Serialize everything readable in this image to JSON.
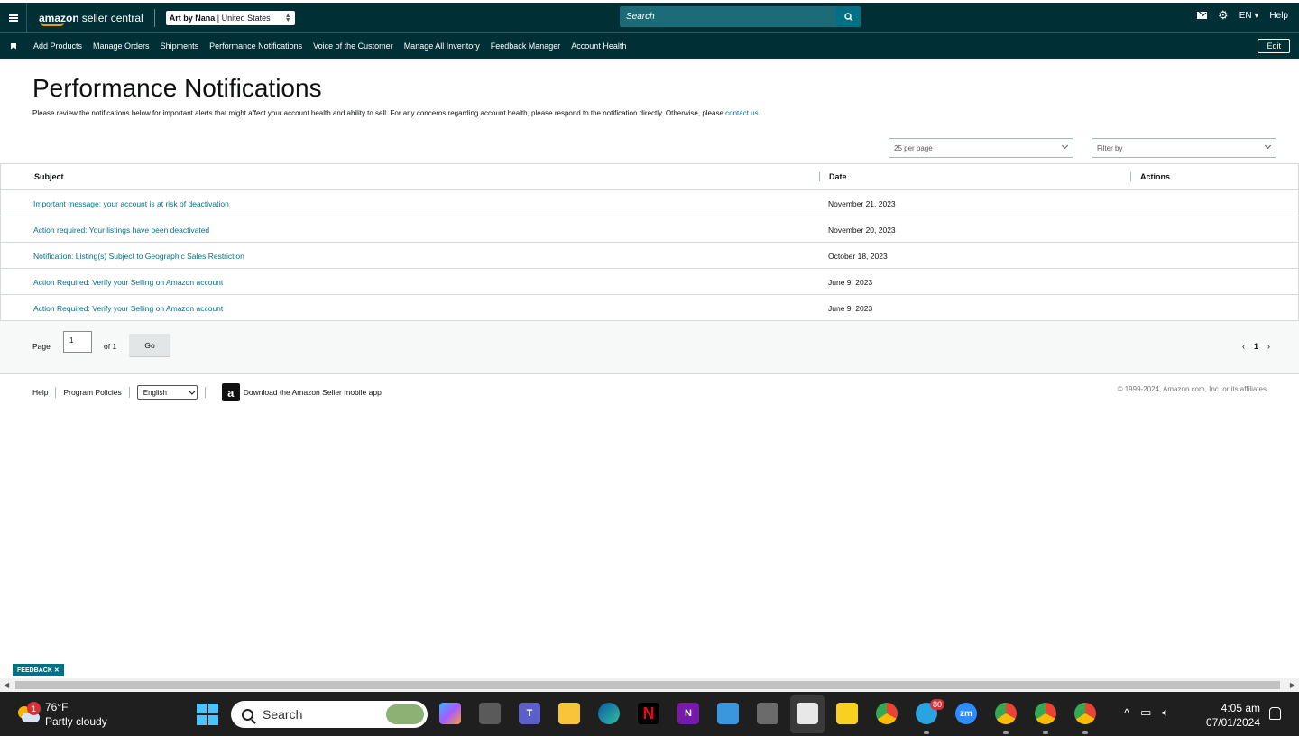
{
  "header": {
    "logo_brand": "amazon",
    "logo_product": "seller central",
    "store_name": "Art by Nana",
    "marketplace": "United States",
    "search_placeholder": "Search",
    "language": "EN",
    "help": "Help"
  },
  "nav": {
    "items": [
      "Add Products",
      "Manage Orders",
      "Shipments",
      "Performance Notifications",
      "Voice of the Customer",
      "Manage All Inventory",
      "Feedback Manager",
      "Account Health"
    ],
    "edit_label": "Edit"
  },
  "page": {
    "title": "Performance Notifications",
    "intro": "Please review the notifications below for important alerts that might affect your account health and ability to sell. For any concerns regarding account health, please respond to the notification directly. Otherwise, please ",
    "intro_link": "contact us.",
    "per_page": "25 per page",
    "filter_placeholder": "Filter by"
  },
  "table": {
    "columns": [
      "Subject",
      "Date",
      "Actions"
    ],
    "rows": [
      {
        "subject": "Important message: your account is at risk of deactivation",
        "date": "November 21, 2023"
      },
      {
        "subject": "Action required: Your listings have been deactivated",
        "date": "November 20, 2023"
      },
      {
        "subject": "Notification: Listing(s) Subject to Geographic Sales Restriction",
        "date": "October 18, 2023"
      },
      {
        "subject": "Action Required: Verify your Selling on Amazon account",
        "date": "June 9, 2023"
      },
      {
        "subject": "Action Required: Verify your Selling on Amazon account",
        "date": "June 9, 2023"
      }
    ]
  },
  "pager": {
    "page_label": "Page",
    "page_value": "1",
    "of_label": "of 1",
    "go_label": "Go",
    "current": "1"
  },
  "footer": {
    "help": "Help",
    "policies": "Program Policies",
    "language": "English",
    "app_text": "Download the Amazon Seller mobile app",
    "copyright": "© 1999-2024, Amazon.com, Inc. or its affiliates"
  },
  "feedback_label": "FEEDBACK ✕",
  "taskbar": {
    "weather_temp": "76°F",
    "weather_desc": "Partly cloudy",
    "weather_badge": "1",
    "search": "Search",
    "telegram_badge": "80",
    "time": "4:05 am",
    "date": "07/01/2024"
  },
  "colors": {
    "header_bg": "#002f36",
    "link": "#007185",
    "search_bg": "#1c6b78"
  }
}
